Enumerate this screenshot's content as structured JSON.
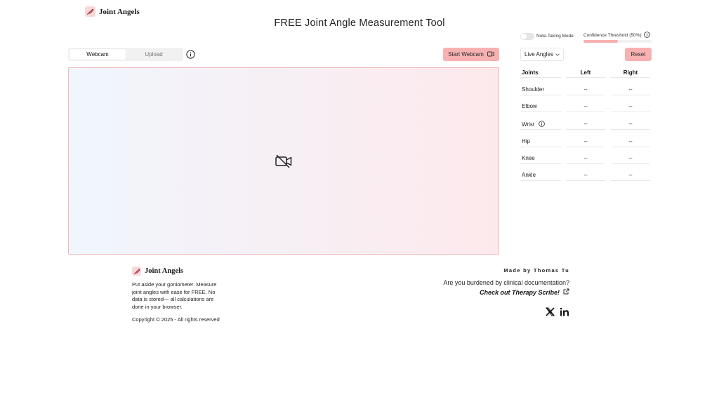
{
  "brand": {
    "name": "Joint Angels",
    "logo_icon": "feather-icon"
  },
  "header": {
    "title": "FREE Joint Angle Measurement Tool"
  },
  "tabs": [
    {
      "label": "Webcam",
      "active": true
    },
    {
      "label": "Upload",
      "active": false
    }
  ],
  "toolbar": {
    "start_label": "Start Webcam",
    "start_icon": "video-camera-icon"
  },
  "video": {
    "icon": "video-off-icon"
  },
  "settings": {
    "note_mode_label": "Note-Taking Mode",
    "note_mode_on": false,
    "confidence_label": "Confidence Threshold (50%)",
    "confidence_value": 0.5,
    "view_select": "Live Angles",
    "reset_label": "Reset"
  },
  "joints_table": {
    "headers": [
      "Joints",
      "Left",
      "Right"
    ],
    "rows": [
      {
        "name": "Shoulder",
        "left": "--",
        "right": "--"
      },
      {
        "name": "Elbow",
        "left": "--",
        "right": "--"
      },
      {
        "name": "Wrist",
        "left": "--",
        "right": "--",
        "has_info": true
      },
      {
        "name": "Hip",
        "left": "--",
        "right": "--"
      },
      {
        "name": "Knee",
        "left": "--",
        "right": "--"
      },
      {
        "name": "Ankle",
        "left": "--",
        "right": "--"
      }
    ]
  },
  "footer": {
    "description": "Put aside your goniometer. Measure joint angles with ease for FREE. No data is stored— all calculations are done in your browser.",
    "copyright": "Copyright © 2025 - All rights reserved",
    "made_by": "Made by Thomas Tu",
    "burden_text": "Are you burdened by clinical documentation?",
    "link_text": "Check out Therapy Scribe!",
    "social": [
      "x-icon",
      "linkedin-icon"
    ]
  },
  "colors": {
    "accent": "#f7b1b1",
    "border": "#f2b8b8"
  }
}
